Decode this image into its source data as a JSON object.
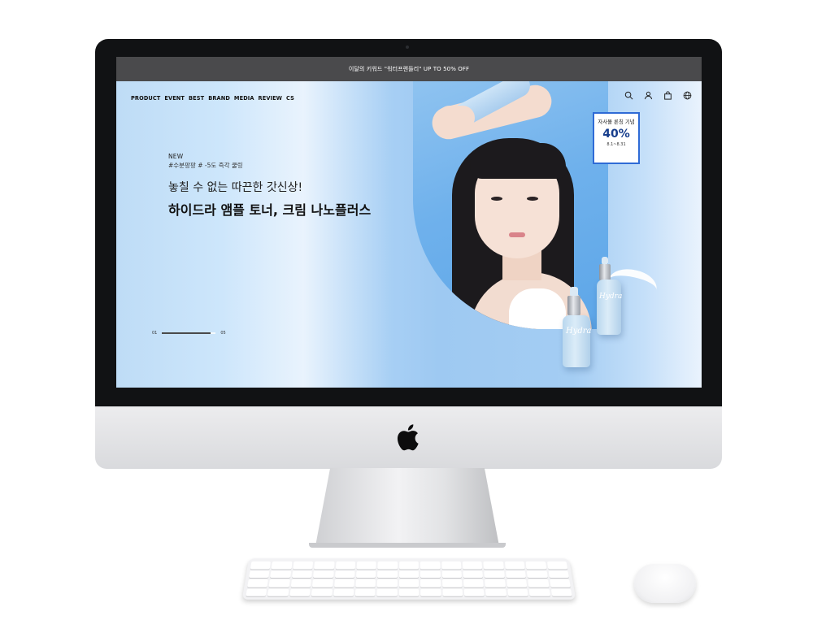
{
  "promo_bar": {
    "text": "이달의 키워드 \"워터프렌들리\" UP TO 50% OFF"
  },
  "nav": {
    "items": [
      {
        "label": "PRODUCT"
      },
      {
        "label": "EVENT"
      },
      {
        "label": "BEST"
      },
      {
        "label": "BRAND"
      },
      {
        "label": "MEDIA"
      },
      {
        "label": "REVIEW"
      },
      {
        "label": "CS"
      }
    ]
  },
  "header_icons": [
    "search-icon",
    "user-icon",
    "cart-icon",
    "globe-icon"
  ],
  "hero": {
    "tag_new": "NEW",
    "hashtags": "#수분팡팡 # -5도 즉각 쿨링",
    "subtitle": "놓칠 수 없는 따끈한 갓신상!",
    "title": "하이드라 앰플 토너, 크림 나노플러스",
    "pager": {
      "current": "01",
      "total": "05",
      "progress": 0.9
    }
  },
  "badge": {
    "title": "자사몰 론칭 기념",
    "percent": "40%",
    "dates": "8.1~8.31"
  },
  "product": {
    "label": "Hydra"
  },
  "colors": {
    "promo_bar_bg": "#4a4a4c",
    "badge_border": "#2f6bd6",
    "badge_accent": "#163d8c",
    "hero_blue": "#9ec9f2"
  }
}
